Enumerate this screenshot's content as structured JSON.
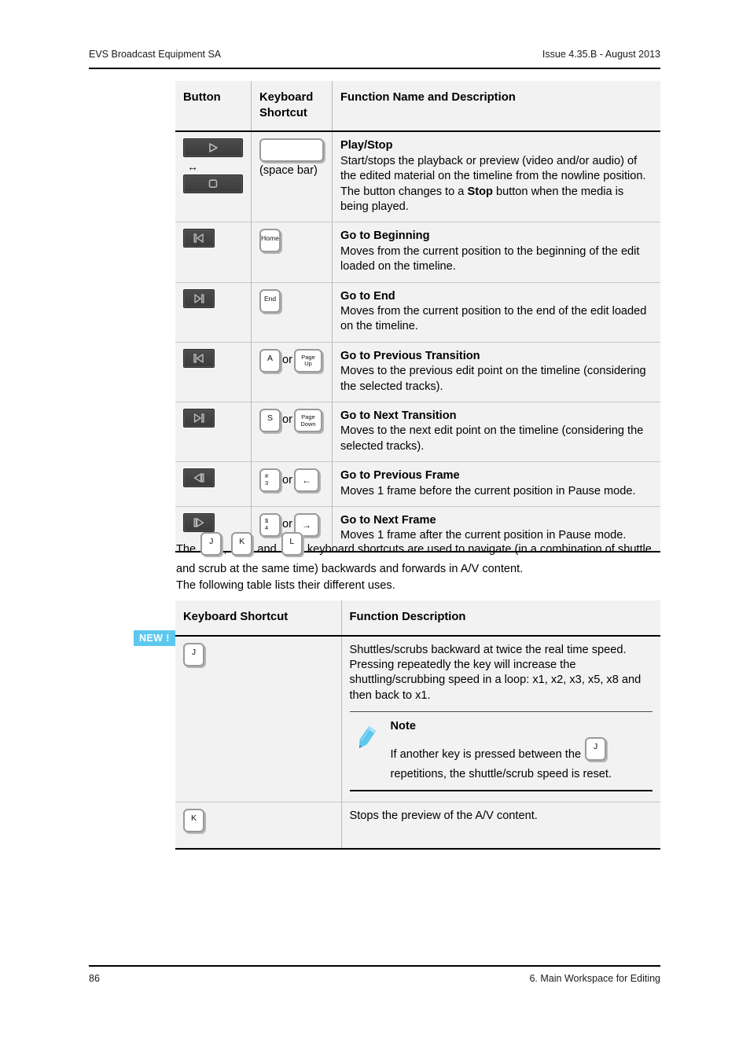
{
  "header": {
    "left": "EVS Broadcast Equipment SA",
    "right": "Issue 4.35.B - August 2013"
  },
  "footer": {
    "page_number": "86",
    "chapter": "6. Main Workspace for Editing"
  },
  "table1": {
    "headers": {
      "button": "Button",
      "shortcut_line1": "Keyboard",
      "shortcut_line2": "Shortcut",
      "function": "Function Name and Description"
    },
    "rows": [
      {
        "button_icons": [
          "play-button-icon",
          "resize-arrows-icon",
          "stop-button-icon"
        ],
        "keys": [
          "space"
        ],
        "space_label": "(space bar)",
        "title": "Play/Stop",
        "desc_part1": "Start/stops the playback or preview (video and/or audio) of the edited material on the timeline from the nowline position.",
        "desc_part2_a": "The button changes to a ",
        "desc_part2_bold": "Stop",
        "desc_part2_b": " button when the media is being played."
      },
      {
        "button_icons": [
          "go-to-beginning-icon"
        ],
        "key_label": "Home",
        "title": "Go to Beginning",
        "desc": "Moves from the current position to the beginning of the edit loaded on the timeline."
      },
      {
        "button_icons": [
          "go-to-end-icon"
        ],
        "key_label": "End",
        "title": "Go to End",
        "desc": "Moves from the current position to the end of the edit loaded on the timeline."
      },
      {
        "button_icons": [
          "go-to-previous-transition-icon"
        ],
        "key_label": "A",
        "or_label": "or",
        "key2_line1": "Page",
        "key2_line2": "Up",
        "title": "Go to Previous Transition",
        "desc": "Moves to the previous edit point on the timeline (considering the selected tracks)."
      },
      {
        "button_icons": [
          "go-to-next-transition-icon"
        ],
        "key_label": "S",
        "or_label": "or",
        "key2_line1": "Page",
        "key2_line2": "Down",
        "title": "Go to Next Transition",
        "desc": "Moves to the next edit point on the timeline (considering the selected tracks)."
      },
      {
        "button_icons": [
          "go-to-previous-frame-icon"
        ],
        "key_top": "#",
        "key_bottom": "3",
        "or_label": "or",
        "key2_glyph": "←",
        "title": "Go to Previous Frame",
        "desc": "Moves 1 frame before the current position in Pause mode."
      },
      {
        "button_icons": [
          "go-to-next-frame-icon"
        ],
        "key_top": "$",
        "key_bottom": "4",
        "or_label": "or",
        "key2_glyph": "→",
        "title": "Go to Next Frame",
        "desc": "Moves 1 frame after the current position in Pause mode."
      }
    ]
  },
  "paragraphs": {
    "intro_a": "The ",
    "intro_key1": "J",
    "intro_comma": ", ",
    "intro_key2": "K",
    "intro_and": " and ",
    "intro_key3": "L",
    "intro_b": " keyboard shortcuts are used to navigate (in a combination of shuttle and scrub at the same time) backwards and forwards in A/V content.",
    "follow": "The following table lists their different uses."
  },
  "table2": {
    "headers": {
      "shortcut": "Keyboard Shortcut",
      "description": "Function Description"
    },
    "new_badge": "NEW !",
    "rows": [
      {
        "key_label": "J",
        "desc": "Shuttles/scrubs backward at twice the real time speed. Pressing repeatedly the key will increase the shuttling/scrubbing speed in a loop: x1, x2, x3, x5, x8 and then back to x1.",
        "note": {
          "icon": "pencil-icon",
          "title": "Note",
          "text_a": "If another key is pressed between the ",
          "text_key": "J",
          "text_b": " repetitions, the shuttle/scrub speed is reset."
        }
      },
      {
        "key_label": "K",
        "desc": "Stops the preview of the A/V content."
      }
    ]
  },
  "colors": {
    "badge_blue": "#5cc8ef",
    "pencil_blue": "#5cc8ef",
    "table_bg": "#f2f2f2",
    "button_dark": "#3f3f3f",
    "icon_gray": "#bdbdbd"
  }
}
